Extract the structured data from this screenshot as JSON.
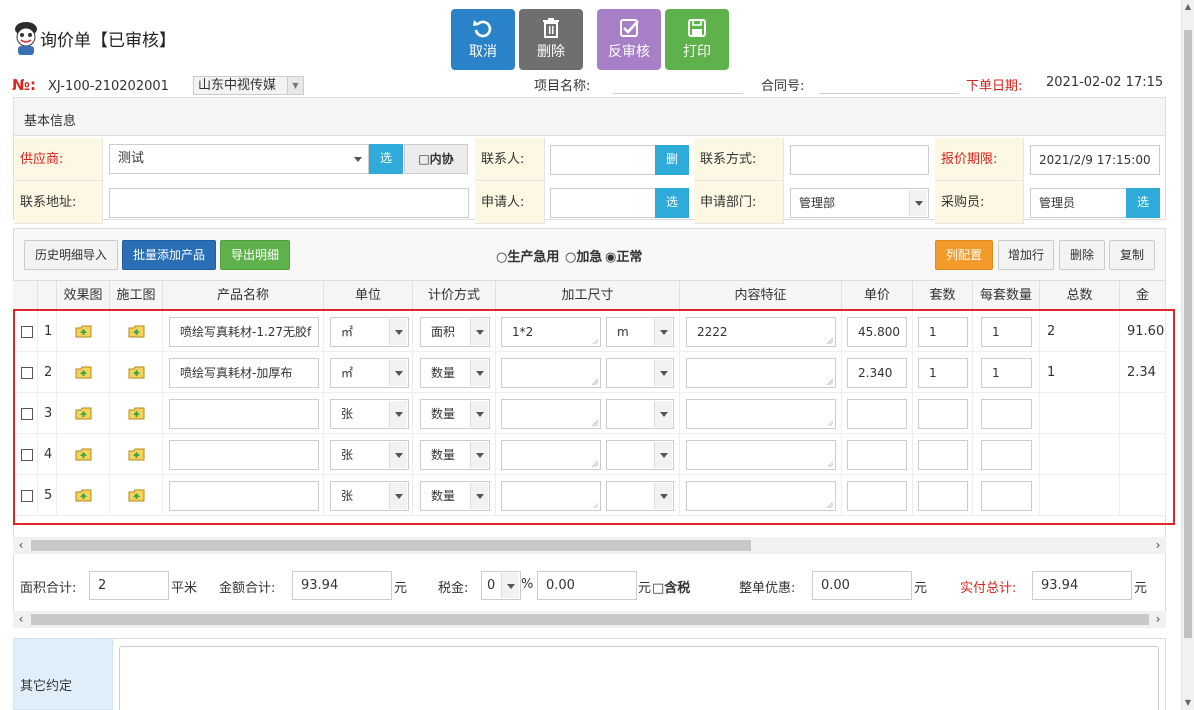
{
  "header": {
    "title": "询价单【已审核】",
    "no_label": "№:",
    "no_value": "XJ-100-210202001",
    "company": "山东中视传媒",
    "project_label": "项目名称:",
    "contract_label": "合同号:",
    "order_date_label": "下单日期:",
    "order_date_value": "2021-02-02 17:15"
  },
  "toolbar": {
    "cancel": "取消",
    "cancel_color": "#2a83c8",
    "delete": "删除",
    "delete_color": "#6f6f6f",
    "unaudit": "反审核",
    "unaudit_color": "#a77fc7",
    "print": "打印",
    "print_color": "#5fb24b"
  },
  "basic": {
    "section_title": "基本信息",
    "supplier_label": "供应商:",
    "supplier_value": "测试",
    "select_btn": "选",
    "internal_label": "□内协",
    "contact_label": "联系人:",
    "delete_btn": "删",
    "contact_method_label": "联系方式:",
    "quote_deadline_label": "报价期限:",
    "quote_deadline_value": "2021/2/9 17:15:00",
    "address_label": "联系地址:",
    "applicant_label": "申请人:",
    "dept_label": "申请部门:",
    "dept_value": "管理部",
    "buyer_label": "采购员:",
    "buyer_value": "管理员"
  },
  "detail_bar": {
    "history_import": "历史明细导入",
    "batch_add": "批量添加产品",
    "export": "导出明细",
    "urgency_prod": "○生产急用",
    "urgency_rush": "○加急",
    "urgency_normal": "◉正常",
    "col_config": "列配置",
    "add_row": "增加行",
    "delete": "删除",
    "copy": "复制"
  },
  "grid": {
    "headers": [
      "效果图",
      "施工图",
      "产品名称",
      "单位",
      "计价方式",
      "加工尺寸",
      "内容特征",
      "单价",
      "套数",
      "每套数量",
      "总数",
      "金"
    ],
    "rows": [
      {
        "no": "1",
        "name": "喷绘写真耗材-1.27无胶f",
        "unit": "㎡",
        "pricing": "面积",
        "size": "1*2",
        "size_unit": "m",
        "feature": "2222",
        "price": "45.800",
        "sets": "1",
        "per_set": "1",
        "total": "2",
        "amount": "91.60"
      },
      {
        "no": "2",
        "name": "喷绘写真耗材-加厚布",
        "unit": "㎡",
        "pricing": "数量",
        "size": "",
        "size_unit": "",
        "feature": "",
        "price": "2.340",
        "sets": "1",
        "per_set": "1",
        "total": "1",
        "amount": "2.34"
      },
      {
        "no": "3",
        "name": "",
        "unit": "张",
        "pricing": "数量",
        "size": "",
        "size_unit": "",
        "feature": "",
        "price": "",
        "sets": "",
        "per_set": "",
        "total": "",
        "amount": ""
      },
      {
        "no": "4",
        "name": "",
        "unit": "张",
        "pricing": "数量",
        "size": "",
        "size_unit": "",
        "feature": "",
        "price": "",
        "sets": "",
        "per_set": "",
        "total": "",
        "amount": ""
      },
      {
        "no": "5",
        "name": "",
        "unit": "张",
        "pricing": "数量",
        "size": "",
        "size_unit": "",
        "feature": "",
        "price": "",
        "sets": "",
        "per_set": "",
        "total": "",
        "amount": ""
      }
    ]
  },
  "totals": {
    "area_label": "面积合计:",
    "area_value": "2",
    "area_unit": "平米",
    "amount_label": "金额合计:",
    "amount_value": "93.94",
    "yuan": "元",
    "tax_label": "税金:",
    "tax_rate": "0",
    "percent": "%",
    "tax_value": "0.00",
    "tax_incl": "□含税",
    "discount_label": "整单优惠:",
    "discount_value": "0.00",
    "actual_label": "实付总计:",
    "actual_value": "93.94"
  },
  "other": {
    "label": "其它约定"
  }
}
